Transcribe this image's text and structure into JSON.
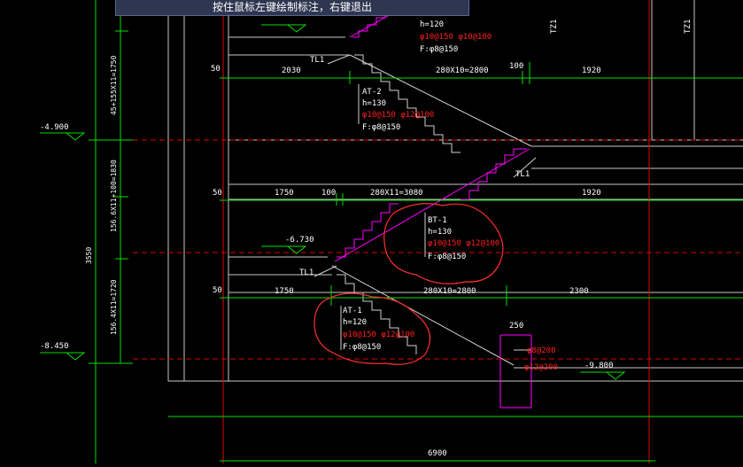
{
  "tooltip": "按住鼠标左键绘制标注，右键退出",
  "colors": {
    "background": "#000000",
    "dim_green": "#00e000",
    "text_white": "#ffffff",
    "red": "#ff2020",
    "magenta": "#ff00ff",
    "grid_red": "#e00000",
    "cloud": "#ff3030"
  },
  "elevations": {
    "e1": "-4.900",
    "e2": "-6.730",
    "e3": "-8.450",
    "e4": "-9.800"
  },
  "left_dims": {
    "d1": "45+155X11=1750",
    "d2": "156.6X11+100=1830",
    "d3": "3550",
    "d4": "156.4X11=1720"
  },
  "row1": {
    "a": "50",
    "b": "2030",
    "c": "280X10=2800",
    "d": "100",
    "e": "1920"
  },
  "row2": {
    "a": "50",
    "b": "1750",
    "c": "100",
    "d": "280X11=3080",
    "e": "1920"
  },
  "row3": {
    "a": "50",
    "b": "1750",
    "c": "280X10=2800",
    "d": "2300"
  },
  "bottom_dim": "6900",
  "tz": {
    "t1": "TZ1",
    "t2": "TZ1"
  },
  "top_stair": {
    "h": "h=120",
    "rebar": "φ10@150 φ10@100",
    "f": "F:φ8@150"
  },
  "at2": {
    "name": "AT-2",
    "h": "h=130",
    "rebar": "φ10@150 φ12@100",
    "f": "F:φ8@150"
  },
  "bt1": {
    "name": "BT-1",
    "h": "h=130",
    "rebar": "φ10@150 φ12@100",
    "f": "F:φ8@150"
  },
  "at1": {
    "name": "AT-1",
    "h": "h=120",
    "rebar": "φ10@150 φ12@100",
    "f": "F:φ8@150"
  },
  "tl": {
    "t1": "TL1",
    "t2": "TL1",
    "t3": "TL1"
  },
  "column": {
    "width": "250",
    "r1": "φ8@200",
    "r2": "φ12@200"
  }
}
